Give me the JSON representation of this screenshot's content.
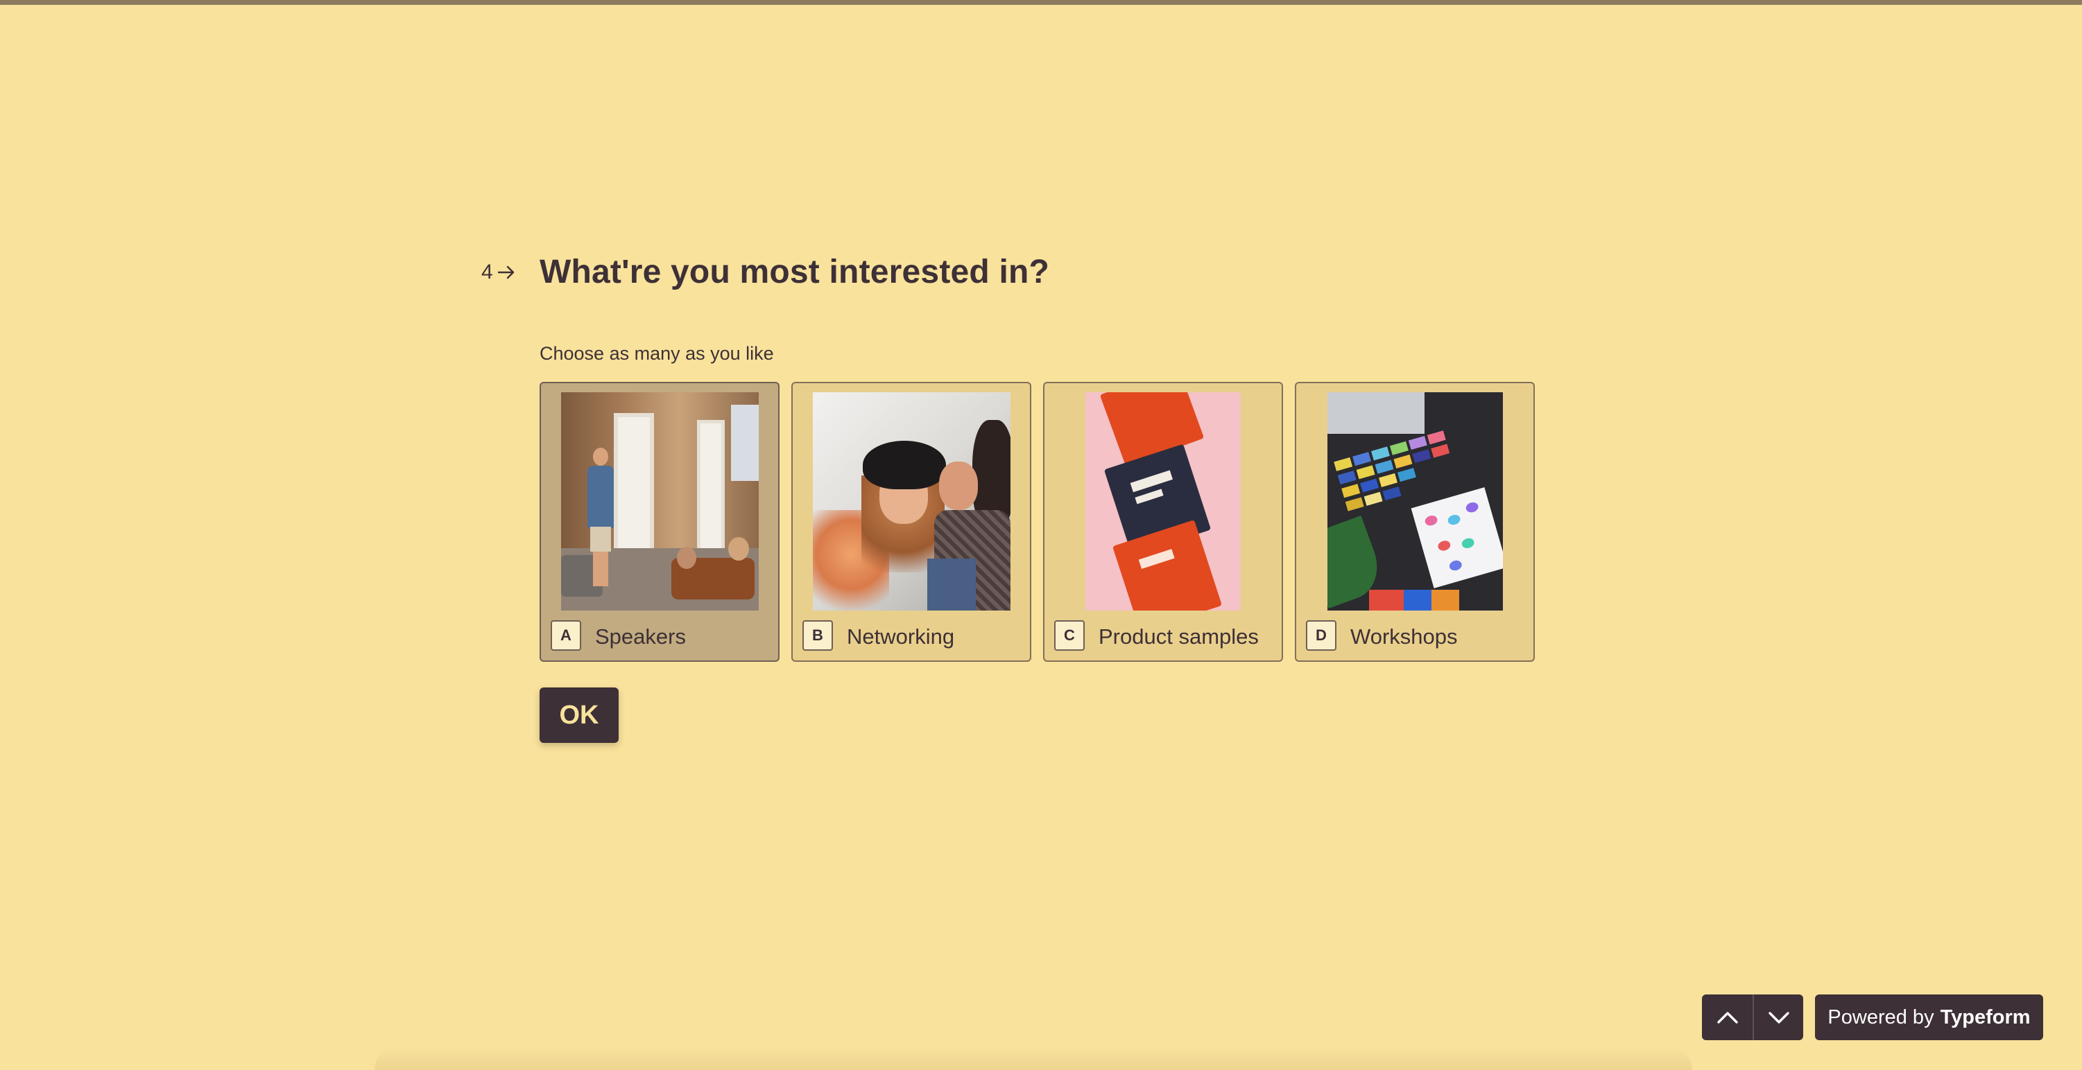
{
  "theme": {
    "background": "#f9e29c",
    "text": "#3d3036",
    "choice_bg": "#e9cf8c",
    "choice_selected_bg": "#c2ab80",
    "button_bg": "#3d3036"
  },
  "question": {
    "number": "4",
    "arrow_icon": "arrow-right-icon",
    "title": "What're you most interested in?",
    "description": "Choose as many as you like"
  },
  "choices": [
    {
      "key": "A",
      "label": "Speakers",
      "selected": true
    },
    {
      "key": "B",
      "label": "Networking",
      "selected": false
    },
    {
      "key": "C",
      "label": "Product samples",
      "selected": false
    },
    {
      "key": "D",
      "label": "Workshops",
      "selected": false
    }
  ],
  "ok_label": "OK",
  "navigation": {
    "up_icon": "chevron-up-icon",
    "down_icon": "chevron-down-icon"
  },
  "powered_by": {
    "prefix": "Powered by",
    "brand": "Typeform"
  }
}
